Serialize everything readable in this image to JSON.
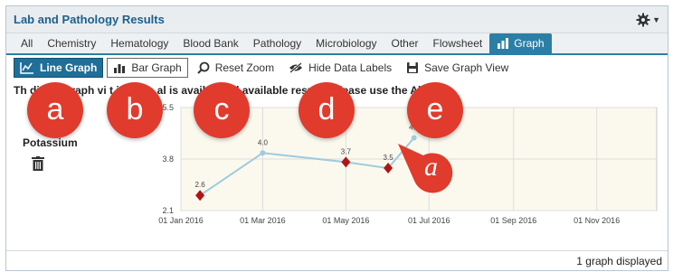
{
  "window": {
    "title": "Lab and Pathology Results"
  },
  "tabs": [
    {
      "label": "All"
    },
    {
      "label": "Chemistry"
    },
    {
      "label": "Hematology"
    },
    {
      "label": "Blood Bank"
    },
    {
      "label": "Pathology"
    },
    {
      "label": "Microbiology"
    },
    {
      "label": "Other"
    },
    {
      "label": "Flowsheet"
    },
    {
      "label": "Graph"
    }
  ],
  "toolbar": {
    "line_graph": "Line Graph",
    "bar_graph": "Bar Graph",
    "reset_zoom": "Reset Zoom",
    "hide_labels": "Hide Data Labels",
    "save_view": "Save Graph View"
  },
  "notice": "Th      displa          graph vi         t include al           is available.          ll available results, please use the All tab.",
  "series_name": "Potassium",
  "footer": "1 graph displayed",
  "annotations": {
    "badges": [
      "a",
      "b",
      "c",
      "d",
      "e"
    ],
    "callout": "a"
  },
  "colors": {
    "accent": "#2b7fa6",
    "badge": "#e03b2c",
    "line": "#9ecbe0",
    "abnormal_marker": "#b01515",
    "plot_bg": "#fbf9ee"
  },
  "chart_data": {
    "type": "line",
    "series": [
      {
        "name": "Potassium",
        "points": [
          {
            "x": "2016-01-15",
            "y": 2.6,
            "label": "2.6",
            "abnormal": true
          },
          {
            "x": "2016-03-01",
            "y": 4.0,
            "label": "4.0",
            "abnormal": false
          },
          {
            "x": "2016-05-01",
            "y": 3.7,
            "label": "3.7",
            "abnormal": true
          },
          {
            "x": "2016-06-01",
            "y": 3.5,
            "label": "3.5",
            "abnormal": true
          },
          {
            "x": "2016-06-20",
            "y": 4.5,
            "label": "4.5",
            "abnormal": false
          }
        ]
      }
    ],
    "x_ticks": [
      "01 Jan 2016",
      "01 Mar 2016",
      "01 May 2016",
      "01 Jul 2016",
      "01 Sep 2016",
      "01 Nov 2016"
    ],
    "x_range": [
      "2016-01-01",
      "2016-12-15"
    ],
    "y_ticks": [
      "2.1",
      "3.8",
      "5.5"
    ],
    "ylim": [
      2.1,
      5.5
    ],
    "grid": true
  }
}
